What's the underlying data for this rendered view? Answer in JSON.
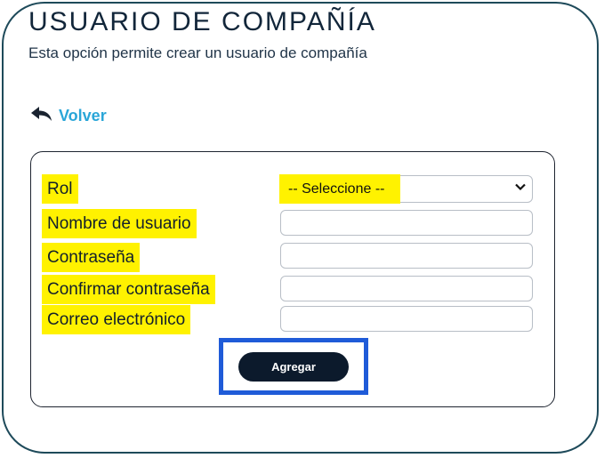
{
  "header": {
    "title": "USUARIO DE COMPAÑÍA",
    "subtitle": "Esta opción permite crear un usuario de compañía"
  },
  "nav": {
    "back_label": "Volver",
    "back_icon": "reply-arrow-icon"
  },
  "form": {
    "fields": [
      {
        "label": "Rol",
        "type": "select",
        "value": "-- Seleccione --"
      },
      {
        "label": "Nombre de usuario",
        "type": "text",
        "value": ""
      },
      {
        "label": "Contraseña",
        "type": "password",
        "value": ""
      },
      {
        "label": "Confirmar contraseña",
        "type": "password",
        "value": ""
      },
      {
        "label": "Correo electrónico",
        "type": "email",
        "value": ""
      }
    ],
    "submit_label": "Agregar"
  },
  "colors": {
    "highlight": "#fff200",
    "link": "#2aa6d8",
    "button_bg": "#0c1a2c",
    "focus_box": "#1f5bd8",
    "frame": "#1e4a5a"
  }
}
